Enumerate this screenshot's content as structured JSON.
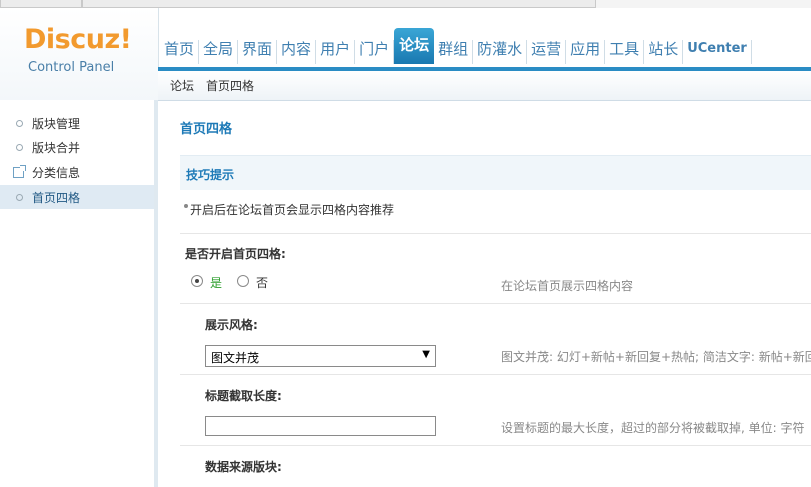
{
  "brand": {
    "logo": "Discuz!",
    "subtitle": "Control Panel"
  },
  "top_nav": [
    {
      "label": "首页"
    },
    {
      "label": "全局"
    },
    {
      "label": "界面"
    },
    {
      "label": "内容"
    },
    {
      "label": "用户"
    },
    {
      "label": "门户"
    },
    {
      "label": "论坛",
      "active": true
    },
    {
      "label": "群组"
    },
    {
      "label": "防灌水"
    },
    {
      "label": "运营"
    },
    {
      "label": "应用"
    },
    {
      "label": "工具"
    },
    {
      "label": "站长"
    },
    {
      "label": "UCenter"
    }
  ],
  "breadcrumb": [
    "论坛",
    "首页四格"
  ],
  "sidebar": {
    "items": [
      {
        "label": "版块管理",
        "icon": "bullet-icon"
      },
      {
        "label": "版块合并",
        "icon": "bullet-icon"
      },
      {
        "label": "分类信息",
        "icon": "external-link-icon"
      },
      {
        "label": "首页四格",
        "icon": "bullet-icon",
        "active": true
      }
    ]
  },
  "main": {
    "title": "首页四格",
    "tips": {
      "title": "技巧提示",
      "items": [
        "开启后在论坛首页会显示四格内容推荐"
      ]
    },
    "enable": {
      "label": "是否开启首页四格:",
      "options": [
        {
          "label": "是",
          "checked": true
        },
        {
          "label": "否",
          "checked": false
        }
      ],
      "desc": "在论坛首页展示四格内容"
    },
    "style": {
      "label": "展示风格:",
      "value": "图文并茂",
      "desc": "图文并茂: 幻灯+新帖+新回复+热帖; 简洁文字: 新帖+新回"
    },
    "title_length": {
      "label": "标题截取长度:",
      "value": "",
      "desc": "设置标题的最大长度，超过的部分将被截取掉, 单位: 字符"
    },
    "source": {
      "label": "数据来源版块:"
    }
  },
  "colors": {
    "accent": "#1e7ab7",
    "nav_active": "#2a8cc4",
    "logo": "#f29a2e",
    "checked_label": "#2a9d2a"
  }
}
